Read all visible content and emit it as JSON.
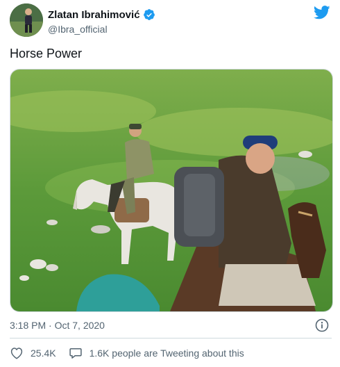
{
  "user": {
    "display_name": "Zlatan Ibrahimović",
    "handle": "@Ibra_official",
    "verified": true
  },
  "tweet": {
    "text": "Horse Power",
    "timestamp": "3:18 PM · Oct 7, 2020"
  },
  "actions": {
    "likes": "25.4K",
    "conversation": "1.6K people are Tweeting about this"
  },
  "icons": {
    "brand": "twitter-bird-icon",
    "verified": "verified-badge-icon",
    "info": "info-icon",
    "like": "heart-icon",
    "reply": "speech-bubble-icon"
  },
  "colors": {
    "brand_blue": "#1d9bf0",
    "text_primary": "#0f1419",
    "text_secondary": "#536471",
    "divider": "#cfd9de"
  }
}
